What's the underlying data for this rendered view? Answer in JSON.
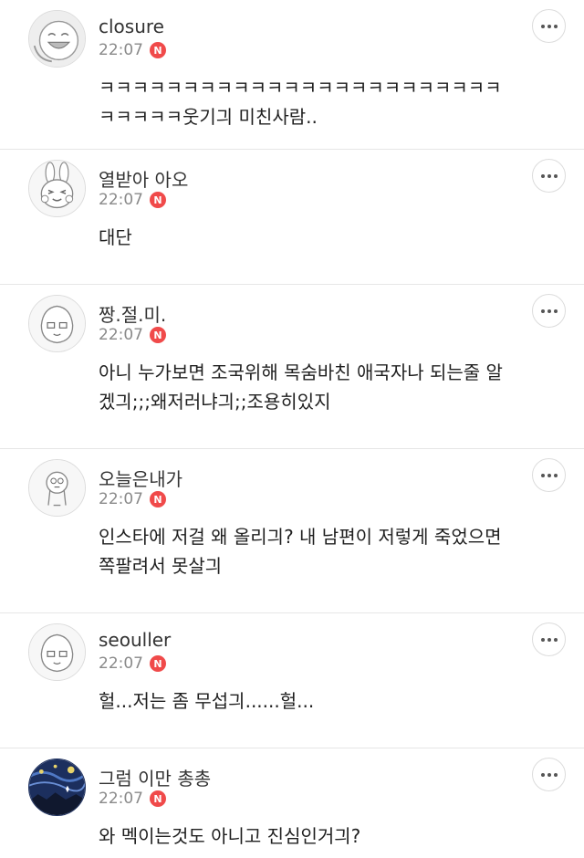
{
  "comments": [
    {
      "nickname": "closure",
      "time": "22:07",
      "badge": "N",
      "avatar": "laughing-face-avatar-icon",
      "lines": [
        "ㅋㅋㅋㅋㅋㅋㅋㅋㅋㅋㅋㅋㅋㅋㅋㅋㅋㅋㅋㅋㅋㅋㅋㅋ",
        "ㅋㅋㅋㅋㅋ웃기긔 미친사람.."
      ]
    },
    {
      "nickname": "열받아 아오",
      "time": "22:07",
      "badge": "N",
      "avatar": "rabbit-character-avatar-icon",
      "lines": [
        "대단"
      ]
    },
    {
      "nickname": "짱.절.미.",
      "time": "22:07",
      "badge": "N",
      "avatar": "peach-character-avatar-icon",
      "lines": [
        "아니 누가보면 조국위해 목숨바친 애국자나 되는줄 알",
        "겠긔;;;왜저러냐긔;;조용히있지"
      ]
    },
    {
      "nickname": "오늘은내가",
      "time": "22:07",
      "badge": "N",
      "avatar": "ghost-character-avatar-icon",
      "lines": [
        "인스타에 저걸 왜 올리긔? 내 남편이 저렇게 죽었으면",
        "쪽팔려서 못살긔"
      ]
    },
    {
      "nickname": "seouller",
      "time": "22:07",
      "badge": "N",
      "avatar": "peach-character-avatar-icon",
      "lines": [
        "헐...저는 좀 무섭긔......헐..."
      ]
    },
    {
      "nickname": "그럼 이만 총총",
      "time": "22:07",
      "badge": "N",
      "avatar": "starry-night-photo-avatar-icon",
      "lines": [
        "와 멕이는것도 아니고 진심인거긔?"
      ]
    }
  ],
  "avatar_colors": {
    "starry_night": "#1c2f5e",
    "badge": "#f04a4a"
  }
}
